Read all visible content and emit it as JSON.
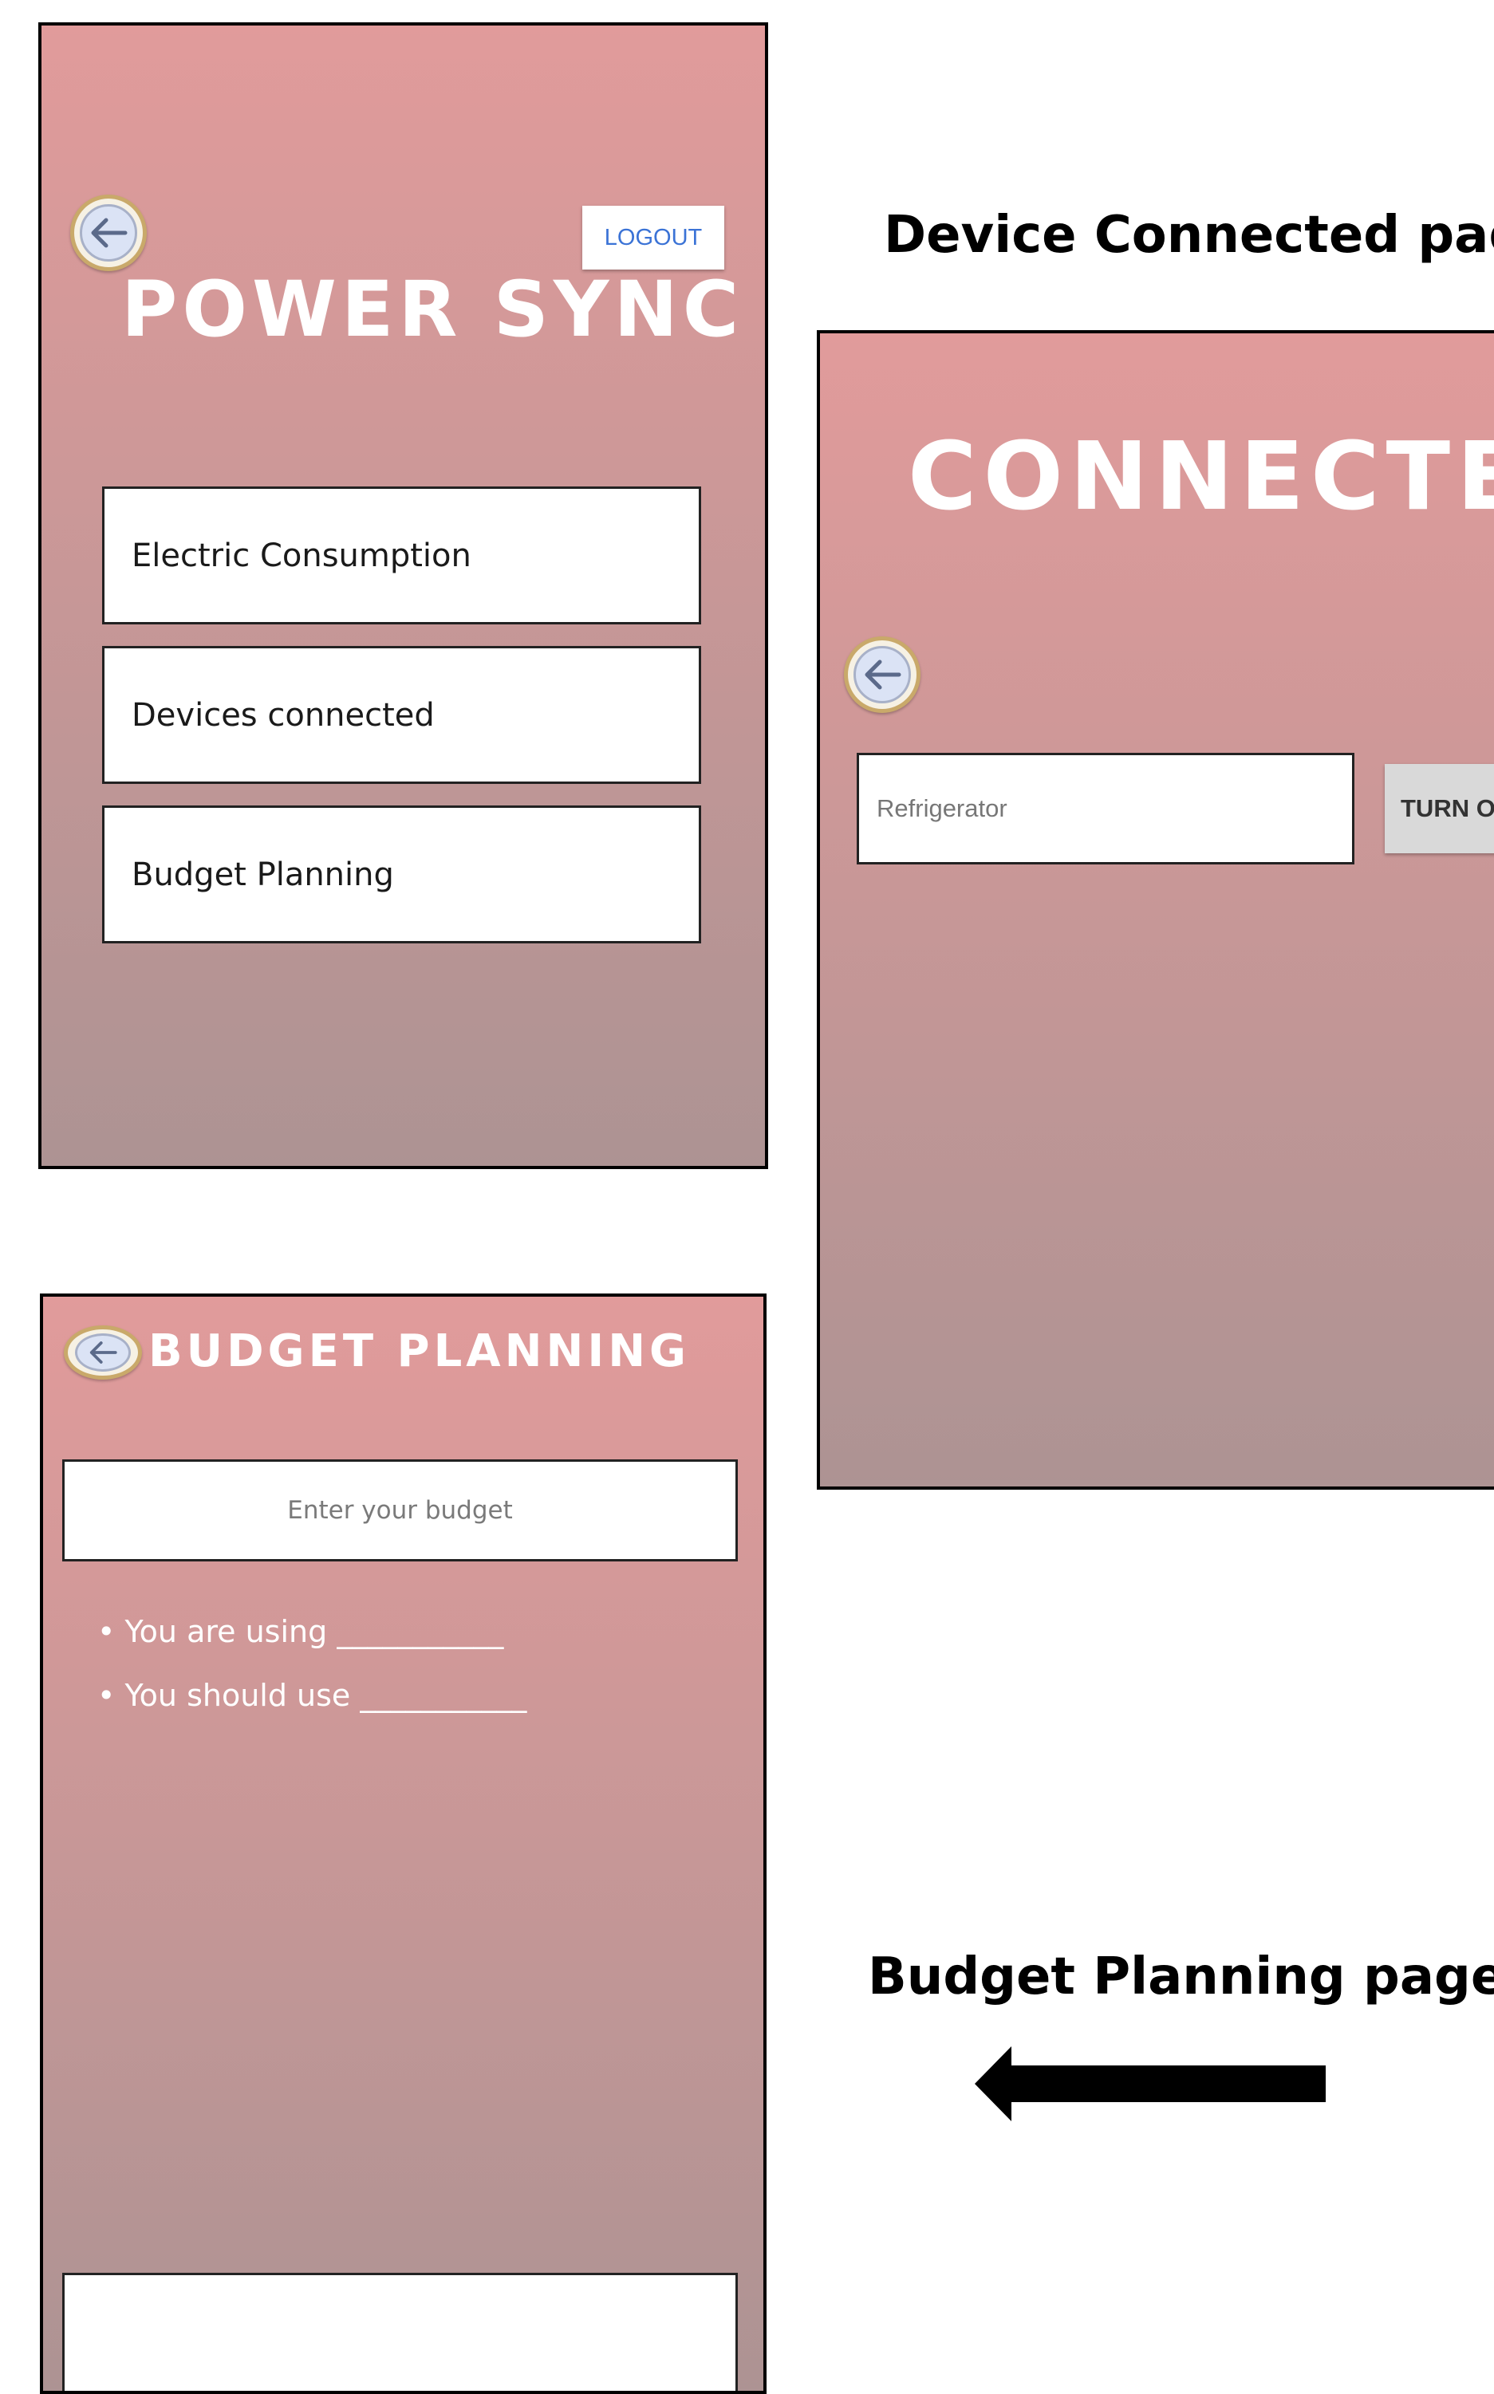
{
  "home_screen": {
    "title": "POWER SYNC",
    "logout_label": "LOGOUT",
    "menu_items": [
      {
        "label": "Electric Consumption"
      },
      {
        "label": "Devices connected"
      },
      {
        "label": "Budget Planning"
      }
    ]
  },
  "connected_screen": {
    "caption": "Device Connected page",
    "title": "CONNECTED",
    "device_name": "Refrigerator",
    "toggle_label": "TURN OF"
  },
  "budget_screen": {
    "caption": "Budget Planning page",
    "title": "BUDGET PLANNING",
    "input_placeholder": "Enter your budget",
    "using_line": "• You are using ___________",
    "should_line": "• You should use ___________"
  },
  "icons": {
    "back": "back-arrow-icon",
    "caption_arrow": "left-arrow-icon"
  },
  "colors": {
    "gradient_top": "#e19b9b",
    "gradient_bottom": "#ad9393",
    "logout_text": "#3b73d6"
  }
}
